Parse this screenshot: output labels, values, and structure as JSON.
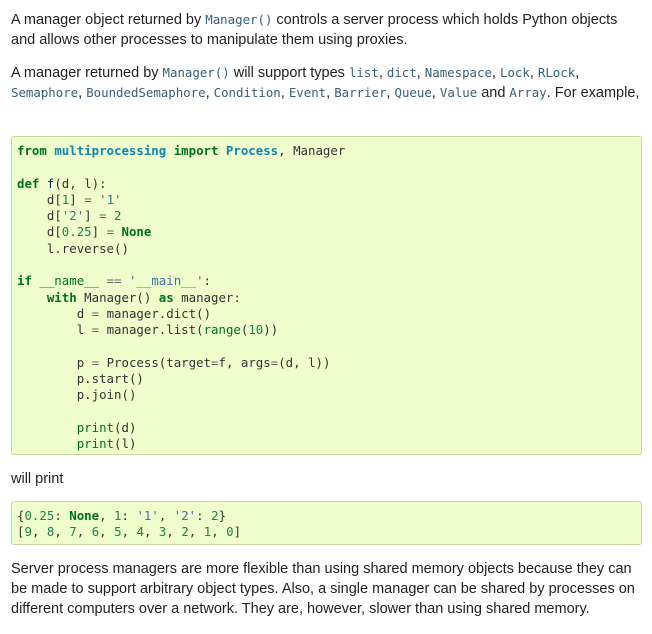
{
  "para1": {
    "before": "A manager object returned by ",
    "code": "Manager()",
    "after": " controls a server process which holds Python objects and allows other processes to manipulate them using proxies."
  },
  "para2": {
    "intro": "A manager returned by ",
    "manager_ref": "Manager()",
    "mid": " will support types ",
    "types": [
      "list",
      "dict",
      "Namespace",
      "Lock",
      "RLock",
      "Semaphore",
      "BoundedSemaphore",
      "Condition",
      "Event",
      "Barrier",
      "Queue",
      "Value",
      "Array"
    ],
    "and_word": " and ",
    "end": ". For example,"
  },
  "code_example": [
    "from multiprocessing import Process, Manager",
    "",
    "def f(d, l):",
    "    d[1] = '1'",
    "    d['2'] = 2",
    "    d[0.25] = None",
    "    l.reverse()",
    "",
    "if __name__ == '__main__':",
    "    with Manager() as manager:",
    "        d = manager.dict()",
    "        l = manager.list(range(10))",
    "",
    "        p = Process(target=f, args=(d, l))",
    "        p.start()",
    "        p.join()",
    "",
    "        print(d)",
    "        print(l)"
  ],
  "will_print": "will print",
  "output": [
    "{0.25: None, 1: '1', '2': 2}",
    "[9, 8, 7, 6, 5, 4, 3, 2, 1, 0]"
  ],
  "para3": "Server process managers are more flexible than using shared memory objects because they can be made to support arbitrary object types. Also, a single manager can be shared by processes on different computers over a network. They are, however, slower than using shared memory."
}
